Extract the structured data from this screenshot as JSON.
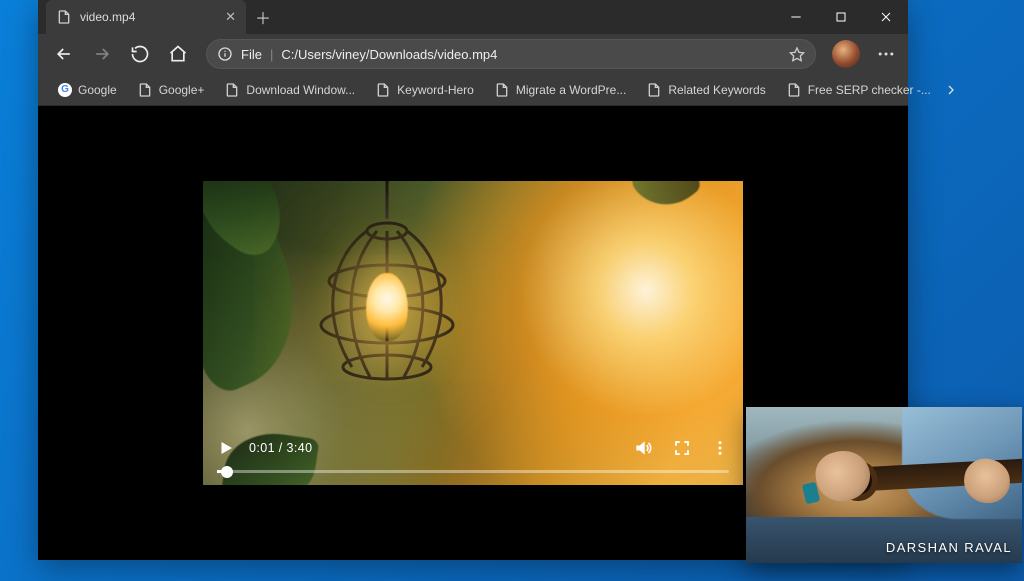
{
  "tab": {
    "title": "video.mp4"
  },
  "address": {
    "scheme_label": "File",
    "separator": "|",
    "path": "C:/Users/viney/Downloads/video.mp4"
  },
  "bookmarks": [
    {
      "label": "Google",
      "icon": "google"
    },
    {
      "label": "Google+",
      "icon": "page"
    },
    {
      "label": "Download Window...",
      "icon": "page"
    },
    {
      "label": "Keyword-Hero",
      "icon": "page"
    },
    {
      "label": "Migrate a WordPre...",
      "icon": "page"
    },
    {
      "label": "Related Keywords",
      "icon": "page"
    },
    {
      "label": "Free SERP checker -...",
      "icon": "page"
    }
  ],
  "video": {
    "current_time": "0:01",
    "duration": "3:40",
    "time_display": "0:01 / 3:40",
    "progress_percent": 2
  },
  "pip": {
    "caption": "DARSHAN RAVAL"
  }
}
